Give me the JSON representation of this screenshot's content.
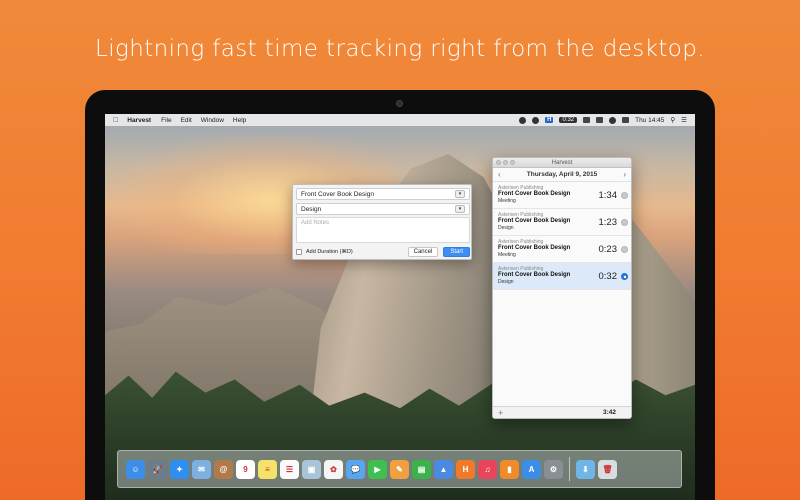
{
  "headline": "Lightning fast time tracking right from the desktop.",
  "menubar": {
    "app_name": "Harvest",
    "items": [
      "File",
      "Edit",
      "Window",
      "Help"
    ],
    "harvest_label": "H",
    "timer": "0:32",
    "clock": "Thu 14:45"
  },
  "dialog": {
    "project": "Front Cover Book Design",
    "task": "Design",
    "notes_placeholder": "Add Notes",
    "add_duration_label": "Add Duration (⌘D)",
    "cancel_label": "Cancel",
    "start_label": "Start"
  },
  "harvest_window": {
    "title": "Harvest",
    "date": "Thursday, April 9, 2015",
    "entries": [
      {
        "client": "Asterisen Publishing",
        "project": "Front Cover Book Design",
        "task": "Meeting",
        "time": "1:34",
        "active": false
      },
      {
        "client": "Asterisen Publishing",
        "project": "Front Cover Book Design",
        "task": "Design",
        "time": "1:23",
        "active": false
      },
      {
        "client": "Asterisen Publishing",
        "project": "Front Cover Book Design",
        "task": "Meeting",
        "time": "0:23",
        "active": false
      },
      {
        "client": "Asterisen Publishing",
        "project": "Front Cover Book Design",
        "task": "Design",
        "time": "0:32",
        "active": true
      }
    ],
    "total": "3:42"
  },
  "dock": {
    "apps": [
      {
        "name": "finder-icon",
        "color": "#3d8ee8",
        "glyph": "☺"
      },
      {
        "name": "launchpad-icon",
        "color": "#6d7c8c",
        "glyph": "🚀"
      },
      {
        "name": "safari-icon",
        "color": "#2f8ff0",
        "glyph": "✦"
      },
      {
        "name": "mail-icon",
        "color": "#7db0e0",
        "glyph": "✉"
      },
      {
        "name": "contacts-icon",
        "color": "#b07a4a",
        "glyph": "@"
      },
      {
        "name": "calendar-icon",
        "color": "#ffffff",
        "glyph": "9"
      },
      {
        "name": "notes-icon",
        "color": "#f5e26a",
        "glyph": "≡"
      },
      {
        "name": "reminders-icon",
        "color": "#fafafa",
        "glyph": "☰"
      },
      {
        "name": "photos-viewer-icon",
        "color": "#a9c4d8",
        "glyph": "▣"
      },
      {
        "name": "photos-icon",
        "color": "#f5f5f5",
        "glyph": "✿"
      },
      {
        "name": "messages-icon",
        "color": "#56a6f2",
        "glyph": "💬"
      },
      {
        "name": "facetime-icon",
        "color": "#3fbf4e",
        "glyph": "▶"
      },
      {
        "name": "pages-icon",
        "color": "#f0a040",
        "glyph": "✎"
      },
      {
        "name": "numbers-icon",
        "color": "#3bb24a",
        "glyph": "▤"
      },
      {
        "name": "keynote-icon",
        "color": "#4a8ae0",
        "glyph": "▲"
      },
      {
        "name": "harvest-icon",
        "color": "#f07a2a",
        "glyph": "H"
      },
      {
        "name": "itunes-icon",
        "color": "#e8455a",
        "glyph": "♫"
      },
      {
        "name": "ibooks-icon",
        "color": "#f08a2a",
        "glyph": "▮"
      },
      {
        "name": "app-store-icon",
        "color": "#3a8ee6",
        "glyph": "A"
      },
      {
        "name": "system-preferences-icon",
        "color": "#8a8f96",
        "glyph": "⚙"
      }
    ],
    "stacks": [
      {
        "name": "downloads-folder-icon",
        "color": "#6fb6e8",
        "glyph": "⬇"
      },
      {
        "name": "trash-icon",
        "color": "#d8dde2",
        "glyph": "🗑"
      }
    ]
  }
}
